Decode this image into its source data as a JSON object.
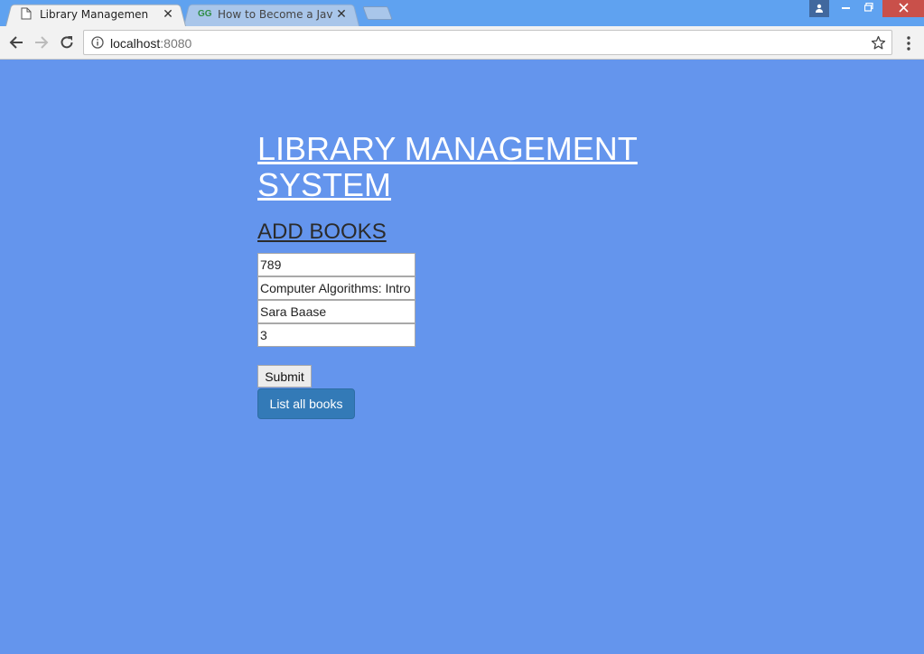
{
  "browser": {
    "tabs": [
      {
        "title": "Library Management",
        "icon": "document-icon",
        "active": true
      },
      {
        "title": "How to Become a JavaSc",
        "icon": "gfg-icon",
        "icon_text": "GG",
        "active": false
      }
    ],
    "address": {
      "host": "localhost",
      "port": ":8080"
    }
  },
  "page": {
    "title": "LIBRARY MANAGEMENT SYSTEM",
    "section_title": "ADD BOOKS",
    "form": {
      "book_id": "789",
      "book_name": "Computer Algorithms: Intro",
      "author": "Sara Baase",
      "copies": "3"
    },
    "submit_label": "Submit",
    "list_label": "List all books"
  },
  "colors": {
    "page_background": "#6495ed",
    "titlebar": "#5fa2f0",
    "primary_button": "#337ab7",
    "close_button": "#c9504a"
  }
}
